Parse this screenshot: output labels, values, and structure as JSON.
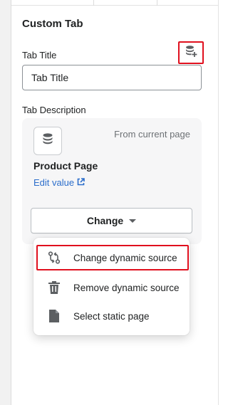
{
  "panel": {
    "section_title": "Custom Tab"
  },
  "tab_title": {
    "label": "Tab Title",
    "value": "Tab Title",
    "connect_source_icon": "database-plus-icon"
  },
  "tab_description": {
    "label": "Tab Description",
    "source_icon": "database-icon",
    "source_origin": "From current page",
    "source_name": "Product Page",
    "edit_link": "Edit value",
    "edit_link_icon": "external-link-icon",
    "change_button": "Change"
  },
  "dropdown": {
    "items": [
      {
        "label": "Change dynamic source",
        "icon": "sync-swap-icon",
        "highlighted": true
      },
      {
        "label": "Remove dynamic source",
        "icon": "trash-icon",
        "highlighted": false
      },
      {
        "label": "Select static page",
        "icon": "page-icon",
        "highlighted": false
      }
    ]
  },
  "colors": {
    "highlight_border": "#e0101e",
    "link": "#2c6ecb",
    "card_bg": "#f6f6f7",
    "text": "#202223",
    "subdued_text": "#6d7175"
  }
}
